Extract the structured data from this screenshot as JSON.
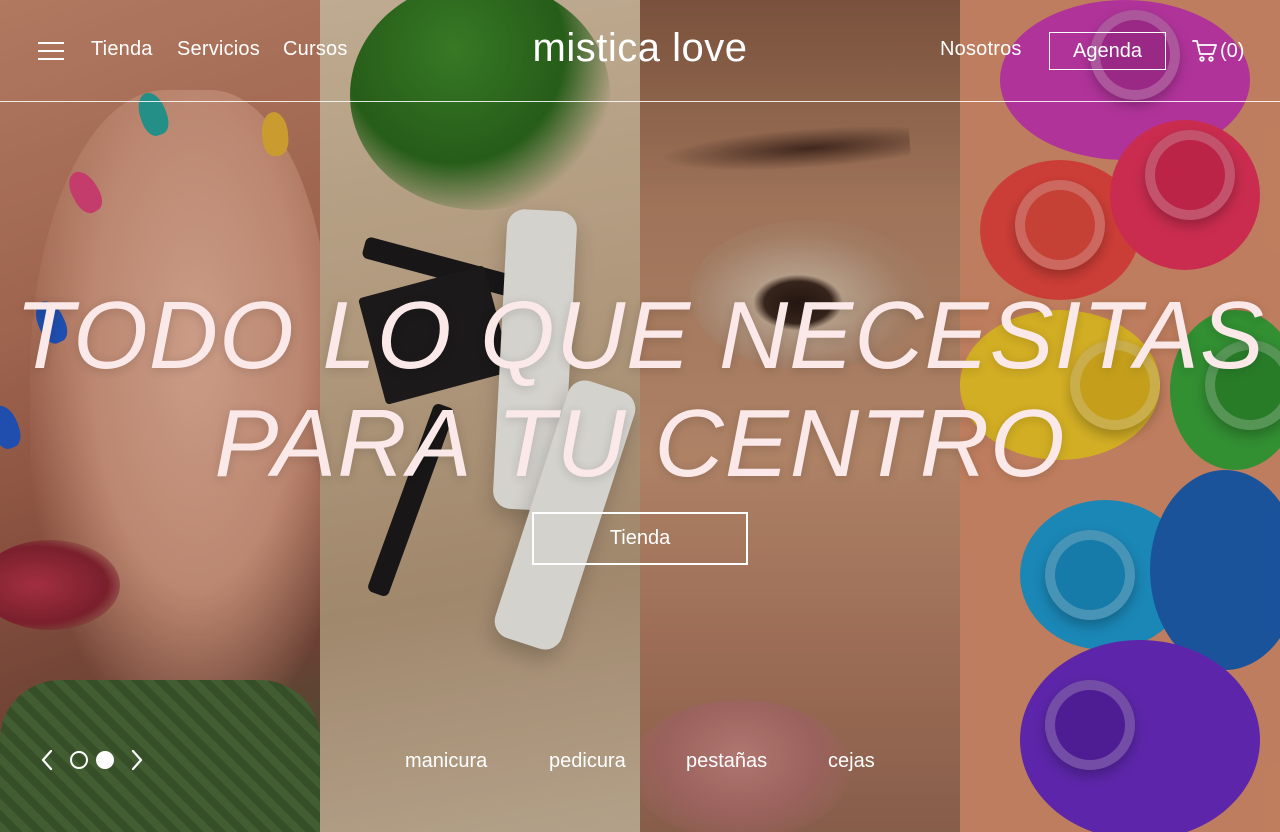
{
  "header": {
    "nav_left": [
      "Tienda",
      "Servicios",
      "Cursos"
    ],
    "brand": "mistica love",
    "nav_right": "Nosotros",
    "agenda_label": "Agenda",
    "cart_count": "(0)"
  },
  "hero": {
    "headline_line1": "TODO LO QUE NECESITAS",
    "headline_line2": "PARA TU CENTRO",
    "cta_label": "Tienda"
  },
  "slider": {
    "slides": 2,
    "active_slide": 2
  },
  "categories": [
    "manicura",
    "pedicura",
    "pestañas",
    "cejas"
  ],
  "icons": [
    "menu-icon",
    "cart-icon",
    "chevron-left-icon",
    "chevron-right-icon"
  ],
  "colors": {
    "text": "#ffffff",
    "headline": "#fbe9e9"
  }
}
